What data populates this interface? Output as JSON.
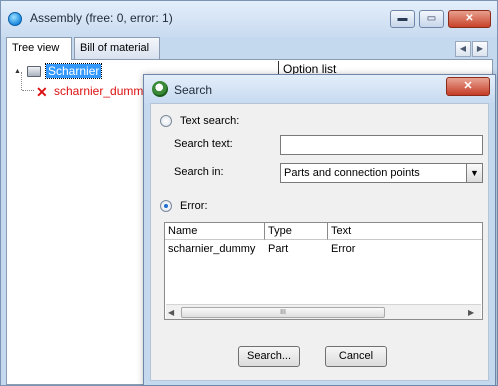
{
  "main_window": {
    "title": "Assembly (free: 0, error: 1)",
    "caption_buttons": {
      "minimize": "▬",
      "maximize": "▭",
      "close": "✕"
    },
    "tabs": [
      {
        "label": "Tree view",
        "active": true
      },
      {
        "label": "Bill of material",
        "active": false
      }
    ],
    "tab_scroll": {
      "left": "◀",
      "right": "▶"
    },
    "tree": {
      "root_label": "Scharnier",
      "child_label": "scharnier_dummy",
      "expander": "▲"
    },
    "option_list_header": "Option list",
    "colors": {
      "selection": "#3399ff",
      "error_text": "#dd1111",
      "window_frame": "#c4d8ee"
    }
  },
  "search_dialog": {
    "title": "Search",
    "close_glyph": "✕",
    "text_search_label": "Text search:",
    "search_text_label": "Search text:",
    "search_text_value": "",
    "search_in_label": "Search in:",
    "search_in_selected": "Parts and connection points",
    "select_arrow": "▼",
    "error_label": "Error:",
    "selected_mode": "error",
    "results": {
      "columns": [
        "Name",
        "Type",
        "Text"
      ],
      "rows": [
        {
          "name": "scharnier_dummy",
          "type": "Part",
          "text": "Error"
        }
      ],
      "scroll": {
        "left": "◀",
        "right": "▶",
        "thumb": "III"
      }
    },
    "buttons": {
      "search": "Search...",
      "cancel": "Cancel"
    }
  }
}
